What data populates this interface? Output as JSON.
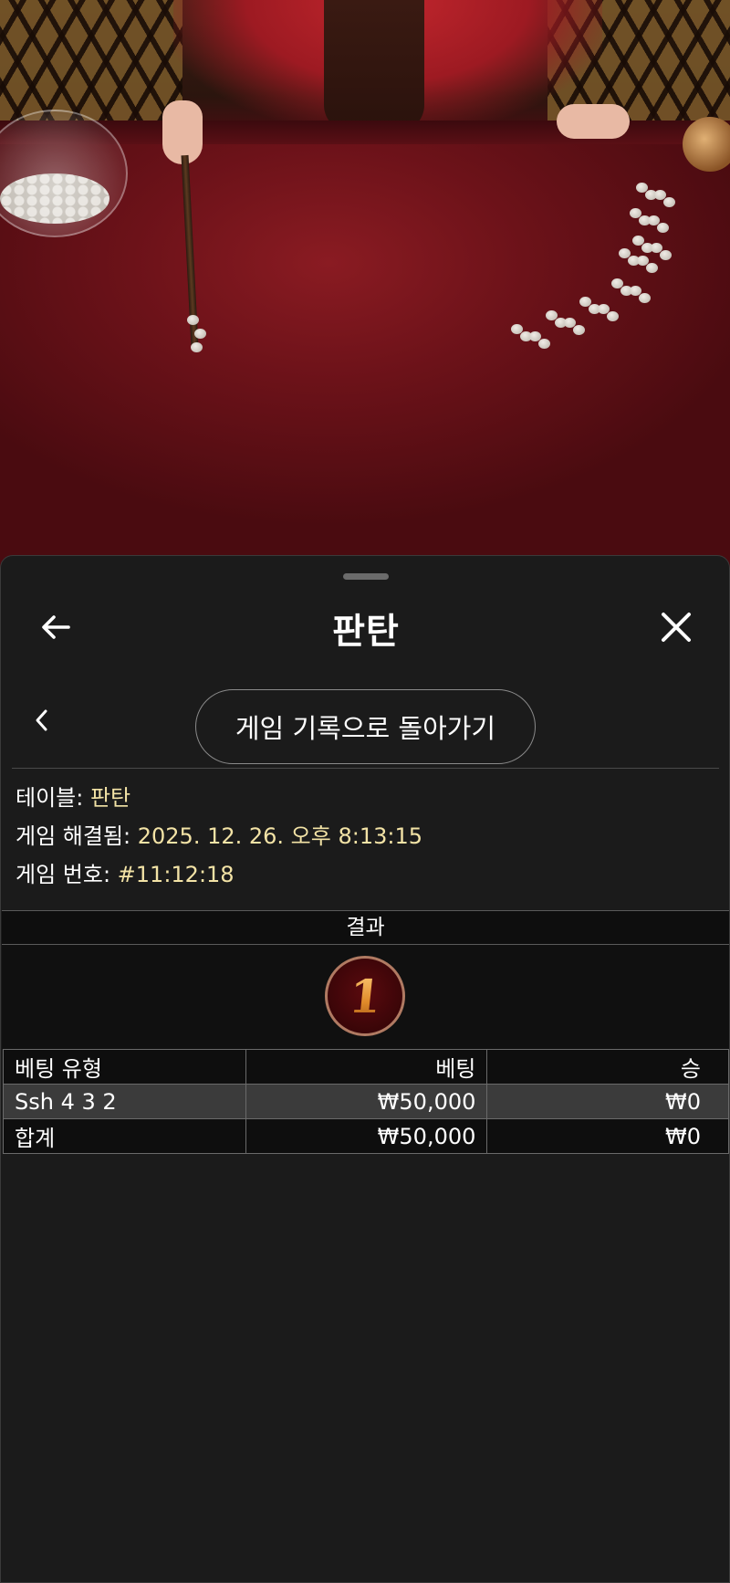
{
  "header": {
    "title": "판탄"
  },
  "nav": {
    "back_to_history_label": "게임 기록으로 돌아가기"
  },
  "info": {
    "table_label": "테이블: ",
    "table_value": "판탄",
    "resolved_label": "게임 해결됨: ",
    "resolved_value": "2025. 12. 26. 오후 8:13:15",
    "game_number_label": "게임 번호: ",
    "game_number_value": "#11:12:18"
  },
  "result": {
    "header": "결과",
    "value": "1"
  },
  "bets_table": {
    "columns": [
      "베팅 유형",
      "베팅",
      "승"
    ],
    "rows": [
      {
        "type": "Ssh 4 3 2",
        "bet": "₩50,000",
        "win": "₩0"
      },
      {
        "type": "합계",
        "bet": "₩50,000",
        "win": "₩0"
      }
    ]
  },
  "colors": {
    "sheet_background": "#1b1b1b",
    "info_value": "#f3e3a6",
    "table_felt": "#7a1219"
  }
}
